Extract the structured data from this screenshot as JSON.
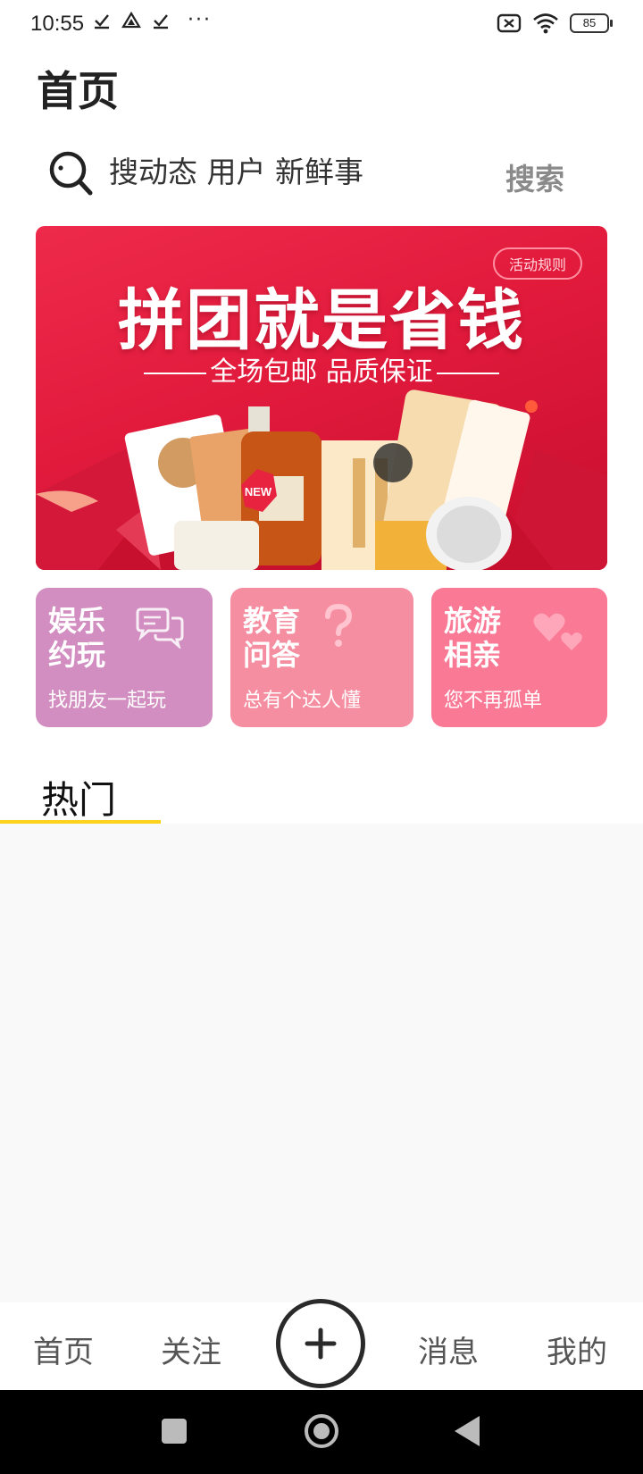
{
  "status_bar": {
    "time": "10:55",
    "battery": "85",
    "more_dots": "···"
  },
  "header": {
    "title": "首页"
  },
  "search": {
    "placeholder": "搜动态 用户 新鲜事",
    "button_label": "搜索"
  },
  "banner": {
    "rule_label": "活动规则",
    "headline": "拼团就是省钱",
    "subline": "全场包邮 品质保证",
    "badge": "NEW",
    "bg_color": "#e11a3c"
  },
  "categories": [
    {
      "title_line1": "娱乐",
      "title_line2": "约玩",
      "subtitle": "找朋友一起玩",
      "icon": "chat-bubbles-icon",
      "color": "#d28ec0"
    },
    {
      "title_line1": "教育",
      "title_line2": "问答",
      "subtitle": "总有个达人懂",
      "icon": "question-mark-icon",
      "color": "#f58ea0"
    },
    {
      "title_line1": "旅游",
      "title_line2": "相亲",
      "subtitle": "您不再孤单",
      "icon": "hearts-icon",
      "color": "#fa7a96"
    }
  ],
  "hot_tab": {
    "label": "热门",
    "accent": "#ffd21e"
  },
  "bottom_nav": {
    "home": "首页",
    "follow": "关注",
    "add_icon": "plus-icon",
    "messages": "消息",
    "mine": "我的"
  }
}
